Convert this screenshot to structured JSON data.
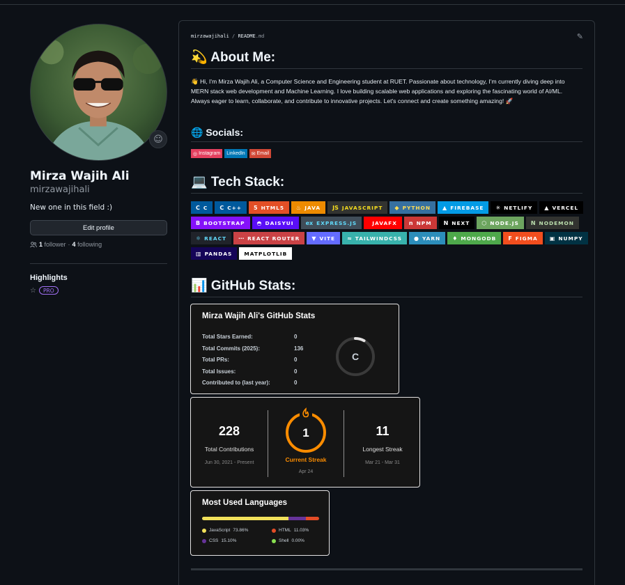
{
  "profile": {
    "name": "Mirza Wajih Ali",
    "login": "mirzawajihali",
    "bio": "New one in this field :)",
    "edit_label": "Edit profile",
    "followers_count": "1",
    "followers_label": "follower",
    "dot": "·",
    "following_count": "4",
    "following_label": "following",
    "highlights_title": "Highlights",
    "pro_label": "PRO"
  },
  "readme": {
    "user": "mirzawajihali",
    "slash": "/",
    "file": "README",
    "ext": ".md",
    "about_title": "💫 About Me:",
    "about_text": "👋 Hi, I'm Mirza Wajih Ali, a Computer Science and Engineering student at RUET. Passionate about technology, I'm currently diving deep into MERN stack web development and Machine Learning. I love building scalable web applications and exploring the fascinating world of AI/ML. Always eager to learn, collaborate, and contribute to innovative projects. Let's connect and create something amazing! 🚀",
    "socials_title": "🌐 Socials:",
    "socials": [
      {
        "label": "Instagram",
        "icon": "instagram-icon",
        "color": "#E4405F"
      },
      {
        "label": "LinkedIn",
        "icon": "linkedin-icon",
        "color": "#0077B5"
      },
      {
        "label": "Email",
        "icon": "gmail-icon",
        "color": "#D14836"
      }
    ],
    "tech_title": "💻 Tech Stack:",
    "tech": [
      {
        "label": "C",
        "bg": "#00599C",
        "fg": "#ffffff",
        "icon": "c-icon",
        "glyph": "C"
      },
      {
        "label": "C++",
        "bg": "#00599C",
        "fg": "#ffffff",
        "icon": "cpp-icon",
        "glyph": "C"
      },
      {
        "label": "HTML5",
        "bg": "#E34F26",
        "fg": "#ffffff",
        "icon": "html5-icon",
        "glyph": "5"
      },
      {
        "label": "JAVA",
        "bg": "#ED8B00",
        "fg": "#ffffff",
        "icon": "java-icon",
        "glyph": "♨"
      },
      {
        "label": "JAVASCRIPT",
        "bg": "#323330",
        "fg": "#F7DF1E",
        "icon": "javascript-icon",
        "glyph": "JS"
      },
      {
        "label": "PYTHON",
        "bg": "#3670A0",
        "fg": "#ffdd54",
        "icon": "python-icon",
        "glyph": "◆"
      },
      {
        "label": "FIREBASE",
        "bg": "#039BE5",
        "fg": "#ffffff",
        "icon": "firebase-icon",
        "glyph": "▲"
      },
      {
        "label": "NETLIFY",
        "bg": "#000000",
        "fg": "#ffffff",
        "icon": "netlify-icon",
        "glyph": "✳"
      },
      {
        "label": "VERCEL",
        "bg": "#000000",
        "fg": "#ffffff",
        "icon": "vercel-icon",
        "glyph": "▲"
      },
      {
        "label": "BOOTSTRAP",
        "bg": "#8511FA",
        "fg": "#ffffff",
        "icon": "bootstrap-icon",
        "glyph": "B"
      },
      {
        "label": "DAISYUI",
        "bg": "#5A0EF8",
        "fg": "#ffffff",
        "icon": "daisyui-icon",
        "glyph": "◓"
      },
      {
        "label": "EXPRESS.JS",
        "bg": "#404d59",
        "fg": "#61DAFB",
        "icon": "express-icon",
        "glyph": "ex"
      },
      {
        "label": "JAVAFX",
        "bg": "#FF0000",
        "fg": "#ffffff",
        "icon": "javafx-icon",
        "glyph": ""
      },
      {
        "label": "NPM",
        "bg": "#CB3837",
        "fg": "#ffffff",
        "icon": "npm-icon",
        "glyph": "n"
      },
      {
        "label": "NEXT",
        "bg": "#000000",
        "fg": "#ffffff",
        "icon": "nextjs-icon",
        "glyph": "N"
      },
      {
        "label": "NODE.JS",
        "bg": "#6DA55F",
        "fg": "#ffffff",
        "icon": "nodejs-icon",
        "glyph": "⬡"
      },
      {
        "label": "NODEMON",
        "bg": "#323330",
        "fg": "#BBDEAD",
        "icon": "nodemon-icon",
        "glyph": "N"
      },
      {
        "label": "REACT",
        "bg": "#20232a",
        "fg": "#61DAFB",
        "icon": "react-icon",
        "glyph": "⚛"
      },
      {
        "label": "REACT ROUTER",
        "bg": "#CA4245",
        "fg": "#ffffff",
        "icon": "react-router-icon",
        "glyph": "⋯"
      },
      {
        "label": "VITE",
        "bg": "#646CFF",
        "fg": "#ffffff",
        "icon": "vite-icon",
        "glyph": "▼"
      },
      {
        "label": "TAILWINDCSS",
        "bg": "#38B2AC",
        "fg": "#ffffff",
        "icon": "tailwind-icon",
        "glyph": "≈"
      },
      {
        "label": "YARN",
        "bg": "#2C8EBB",
        "fg": "#ffffff",
        "icon": "yarn-icon",
        "glyph": "●"
      },
      {
        "label": "MONGODB",
        "bg": "#4ea94b",
        "fg": "#ffffff",
        "icon": "mongodb-icon",
        "glyph": "♦"
      },
      {
        "label": "FIGMA",
        "bg": "#F24E1E",
        "fg": "#ffffff",
        "icon": "figma-icon",
        "glyph": "F"
      },
      {
        "label": "NUMPY",
        "bg": "#013243",
        "fg": "#ffffff",
        "icon": "numpy-icon",
        "glyph": "▣"
      },
      {
        "label": "PANDAS",
        "bg": "#150458",
        "fg": "#ffffff",
        "icon": "pandas-icon",
        "glyph": "▥"
      },
      {
        "label": "MATPLOTLIB",
        "bg": "#ffffff",
        "fg": "#000000",
        "icon": "",
        "glyph": ""
      }
    ],
    "stats_title": "📊 GitHub Stats:"
  },
  "stats": {
    "title": "Mirza Wajih Ali's GitHub Stats",
    "rows": [
      {
        "label": "Total Stars Earned:",
        "value": "0"
      },
      {
        "label": "Total Commits (2025):",
        "value": "136"
      },
      {
        "label": "Total PRs:",
        "value": "0"
      },
      {
        "label": "Total Issues:",
        "value": "0"
      },
      {
        "label": "Contributed to (last year):",
        "value": "0"
      }
    ],
    "rank": "C",
    "rank_progress": 0.08
  },
  "streak": {
    "total": "228",
    "total_label": "Total Contributions",
    "total_range": "Jun 30, 2021 - Present",
    "current": "1",
    "current_label": "Current Streak",
    "current_range": "Apr 24",
    "longest": "11",
    "longest_label": "Longest Streak",
    "longest_range": "Mar 21 - Mar 31"
  },
  "languages": {
    "title": "Most Used Languages",
    "items": [
      {
        "name": "JavaScript",
        "pct": "73.86%",
        "value": 73.86,
        "color": "#f1e05a"
      },
      {
        "name": "HTML",
        "pct": "11.03%",
        "value": 11.03,
        "color": "#e34c26"
      },
      {
        "name": "CSS",
        "pct": "15.10%",
        "value": 15.1,
        "color": "#663399"
      },
      {
        "name": "Shell",
        "pct": "0.00%",
        "value": 0.0,
        "color": "#89e051"
      }
    ]
  }
}
